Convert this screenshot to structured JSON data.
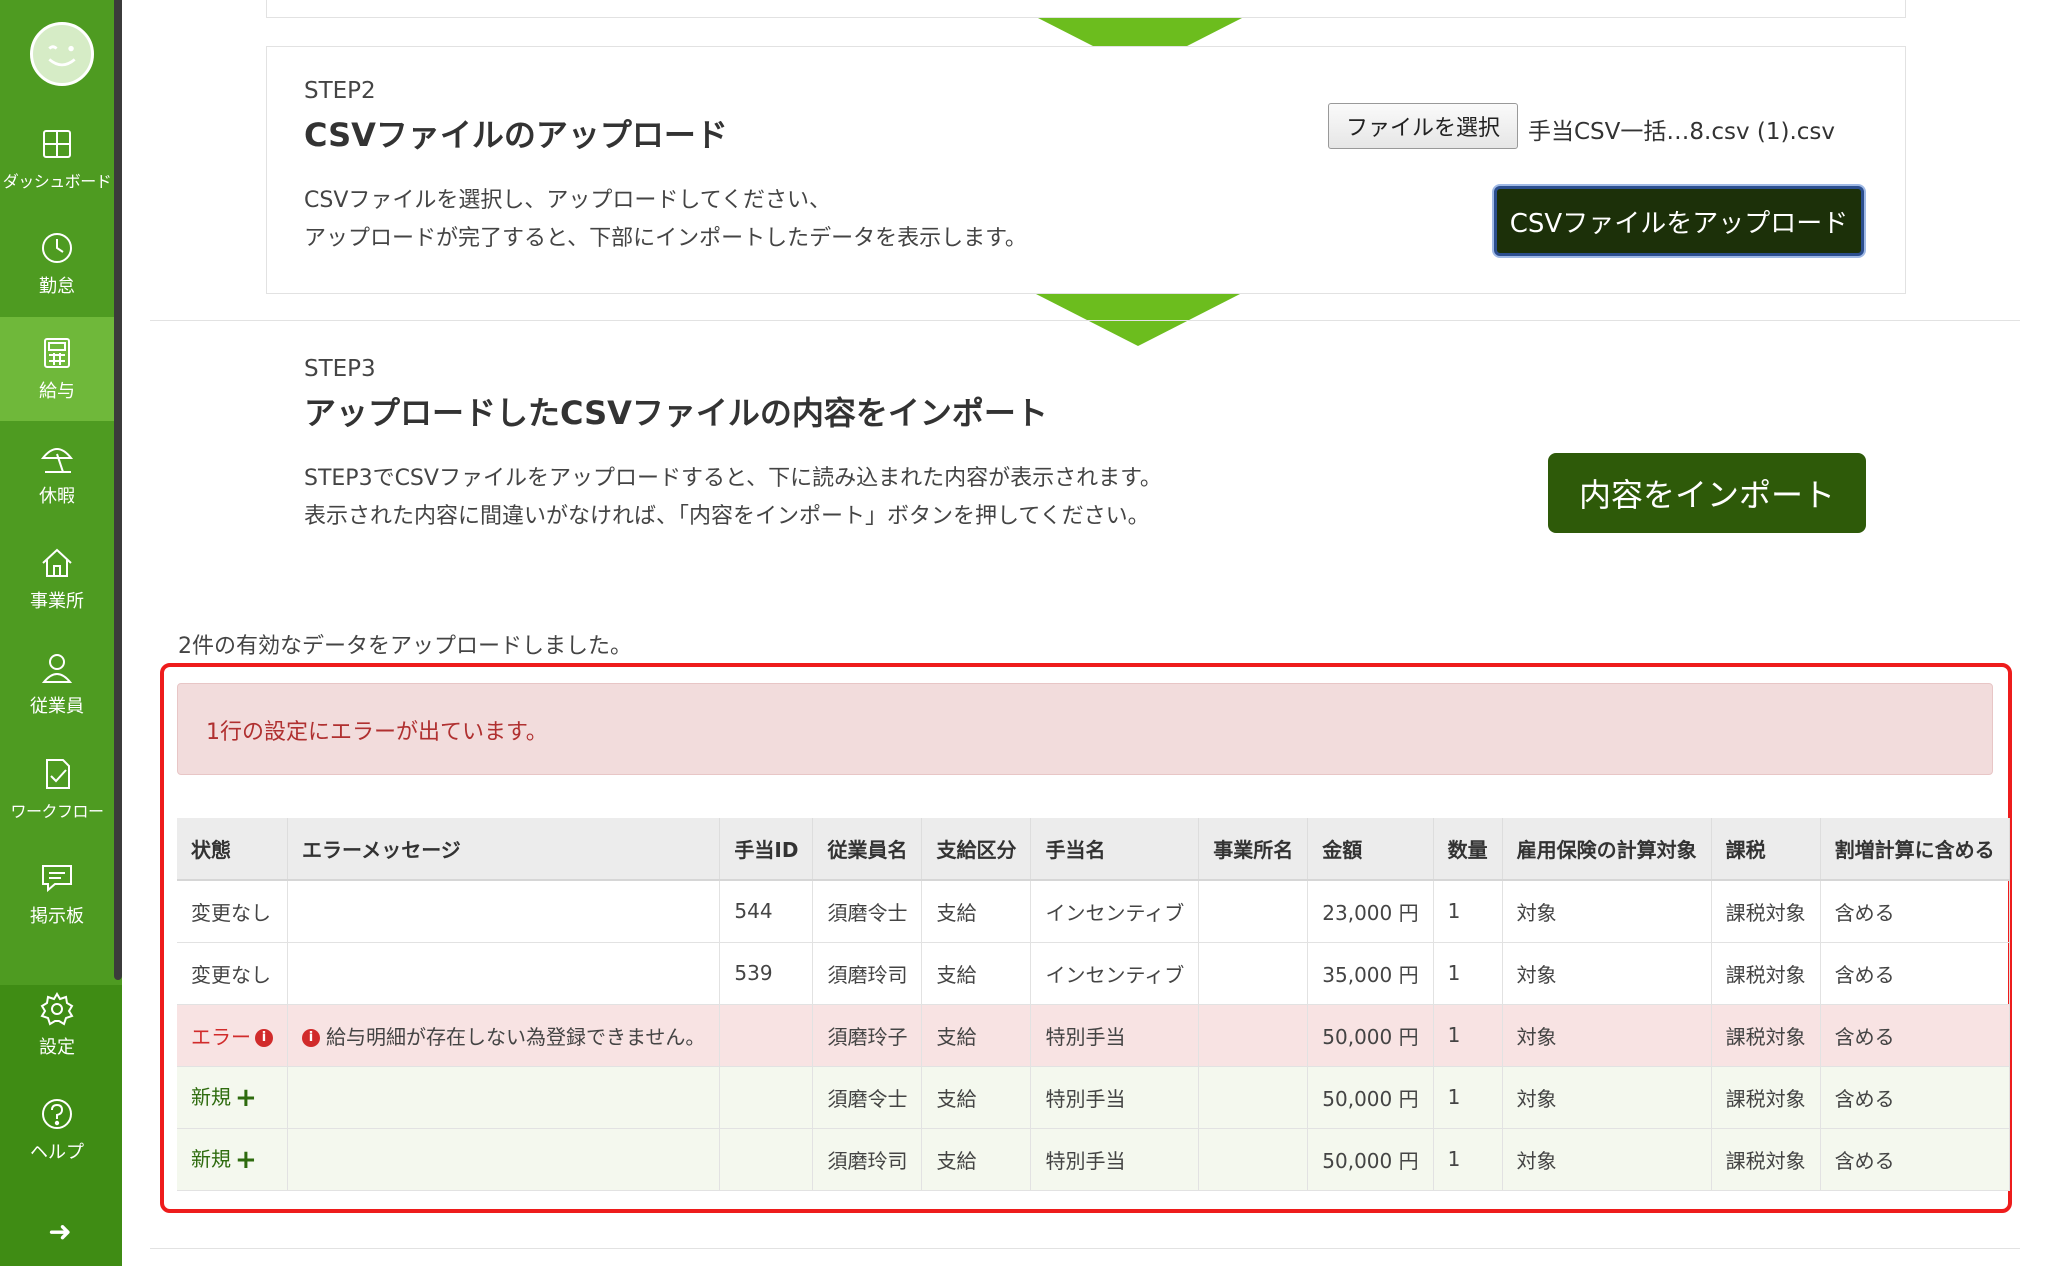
{
  "sidebar": {
    "items": [
      {
        "label": "ダッシュボード",
        "icon": "dashboard-icon"
      },
      {
        "label": "勤怠",
        "icon": "clock-icon"
      },
      {
        "label": "給与",
        "icon": "calculator-icon"
      },
      {
        "label": "休暇",
        "icon": "beach-umbrella-icon"
      },
      {
        "label": "事業所",
        "icon": "home-icon"
      },
      {
        "label": "従業員",
        "icon": "person-icon"
      },
      {
        "label": "ワークフロー",
        "icon": "checklist-icon"
      },
      {
        "label": "掲示板",
        "icon": "chat-icon"
      },
      {
        "label": "設定",
        "icon": "gear-icon"
      },
      {
        "label": "ヘルプ",
        "icon": "help-icon"
      }
    ],
    "collapse": "➜"
  },
  "step2": {
    "label": "STEP2",
    "title": "CSVファイルのアップロード",
    "desc_line1": "CSVファイルを選択し、アップロードしてください、",
    "desc_line2": "アップロードが完了すると、下部にインポートしたデータを表示します。",
    "file_button": "ファイルを選択",
    "file_name": "手当CSV一括…8.csv (1).csv",
    "upload_button": "CSVファイルをアップロード"
  },
  "step3": {
    "label": "STEP3",
    "title": "アップロードしたCSVファイルの内容をインポート",
    "desc_line1": "STEP3でCSVファイルをアップロードすると、下に読み込まれた内容が表示されます。",
    "desc_line2": "表示された内容に間違いがなければ、「内容をインポート」ボタンを押してください。",
    "import_button": "内容をインポート"
  },
  "upload_message": "2件の有効なデータをアップロードしました。",
  "error_alert": "1行の設定にエラーが出ています。",
  "table": {
    "headers": [
      "状態",
      "エラーメッセージ",
      "手当ID",
      "従業員名",
      "支給区分",
      "手当名",
      "事業所名",
      "金額",
      "数量",
      "雇用保険の計算対象",
      "課税",
      "割増計算に含める"
    ],
    "rows": [
      {
        "status": "変更なし",
        "message": "",
        "id": "544",
        "employee": "須磨令士",
        "kubun": "支給",
        "allowance": "インセンティブ",
        "office": "",
        "amount": "23,000 円",
        "qty": "1",
        "insurance": "対象",
        "tax": "課税対象",
        "premium": "含める"
      },
      {
        "status": "変更なし",
        "message": "",
        "id": "539",
        "employee": "須磨玲司",
        "kubun": "支給",
        "allowance": "インセンティブ",
        "office": "",
        "amount": "35,000 円",
        "qty": "1",
        "insurance": "対象",
        "tax": "課税対象",
        "premium": "含める"
      },
      {
        "status": "エラー",
        "message": "給与明細が存在しない為登録できません。",
        "id": "",
        "employee": "須磨玲子",
        "kubun": "支給",
        "allowance": "特別手当",
        "office": "",
        "amount": "50,000 円",
        "qty": "1",
        "insurance": "対象",
        "tax": "課税対象",
        "premium": "含める"
      },
      {
        "status": "新規",
        "message": "",
        "id": "",
        "employee": "須磨令士",
        "kubun": "支給",
        "allowance": "特別手当",
        "office": "",
        "amount": "50,000 円",
        "qty": "1",
        "insurance": "対象",
        "tax": "課税対象",
        "premium": "含める"
      },
      {
        "status": "新規",
        "message": "",
        "id": "",
        "employee": "須磨玲司",
        "kubun": "支給",
        "allowance": "特別手当",
        "office": "",
        "amount": "50,000 円",
        "qty": "1",
        "insurance": "対象",
        "tax": "課税対象",
        "premium": "含める"
      }
    ]
  },
  "colors": {
    "sidebar": "#4e9b21",
    "sidebar_active": "#6fb83a",
    "import_button": "#2e5a09",
    "error_frame": "#ee1c1c",
    "error_bg": "#f2dcdc"
  }
}
